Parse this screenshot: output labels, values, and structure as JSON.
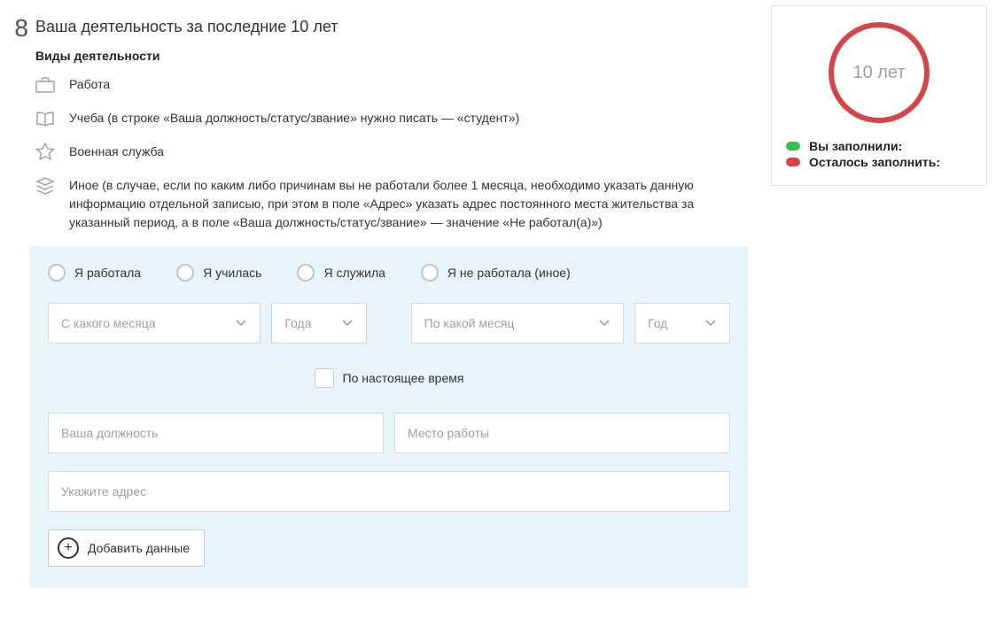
{
  "section": {
    "number": "8",
    "title": "Ваша деятельность за последние 10 лет"
  },
  "types": {
    "heading": "Виды деятельности",
    "work": "Работа",
    "study": "Учеба (в строке «Ваша должность/статус/звание» нужно писать — «студент»)",
    "military": "Военная служба",
    "other": "Иное (в случае, если по каким либо причинам вы не работали более 1 месяца, необходимо указать данную информацию отдельной записью, при этом в поле «Адрес» указать адрес постоянного места жительства за указанный период, а в поле «Ваша должность/статус/звание» — значение «Не работал(а)»)"
  },
  "radios": {
    "worked": "Я работала",
    "studied": "Я училась",
    "served": "Я служила",
    "not_worked": "Я не работала (иное)"
  },
  "selects": {
    "from_month": "С какого месяца",
    "from_year": "Года",
    "to_month": "По какой месяц",
    "to_year": "Год"
  },
  "present_label": "По настоящее время",
  "inputs": {
    "position": "Ваша должность",
    "place": "Место работы",
    "address": "Укажите адрес"
  },
  "add_button": "Добавить данные",
  "status": {
    "ring_text": "10 лет",
    "filled": "Вы заполнили:",
    "remaining": "Осталось заполнить:"
  }
}
